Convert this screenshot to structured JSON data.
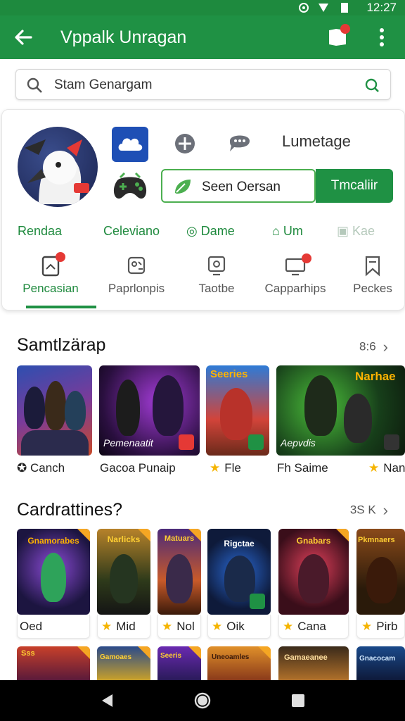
{
  "status": {
    "time": "12:27"
  },
  "appbar": {
    "title": "Vppalk Unragan"
  },
  "search": {
    "placeholder": "Stam Genargam"
  },
  "profile": {
    "quick_label": "Lumetage",
    "seen_button": "Seen Oersan",
    "green_button": "Tmcaliir",
    "chips": [
      "Rendaa",
      "Celeviano",
      "Dame",
      "Um",
      "Kae"
    ],
    "tabs": [
      "Pencasian",
      "Paprlonpis",
      "Taotbe",
      "Capparhips",
      "Peckes"
    ]
  },
  "section1": {
    "title": "Samtlzärap",
    "more": "8:6",
    "items": [
      {
        "caption": "Canch",
        "tile_text": ""
      },
      {
        "caption": "Gacoa Punaip",
        "tile_text": "Pemenaatit"
      },
      {
        "caption": "Fle",
        "tile_text": "Seeries"
      },
      {
        "caption": "Fh Saime",
        "tile_text": "Aepvdis"
      },
      {
        "caption": "Nan",
        "tile_text": "Narhae"
      }
    ]
  },
  "section2": {
    "title": "Cardrattines?",
    "more": "3S K",
    "items": [
      {
        "caption": "Oed",
        "tile_text": "Gnamorabes"
      },
      {
        "caption": "Mid",
        "tile_text": "Narlicks"
      },
      {
        "caption": "Nol",
        "tile_text": "Matuars"
      },
      {
        "caption": "Oik",
        "tile_text": "Rigctae"
      },
      {
        "caption": "Cana",
        "tile_text": "Gnabars"
      },
      {
        "caption": "Pirb",
        "tile_text": "Pkmnaers"
      }
    ]
  },
  "section3": {
    "items": [
      {
        "tile_text": "Sss"
      },
      {
        "tile_text": "Gamoaes"
      },
      {
        "tile_text": "Seeris"
      },
      {
        "tile_text": "Uneoamles"
      },
      {
        "tile_text": "Gamaeanee"
      },
      {
        "tile_text": "Gnacocam"
      }
    ]
  },
  "colors": {
    "primary": "#1f9144",
    "accent_red": "#e53935",
    "star": "#f5b400"
  }
}
